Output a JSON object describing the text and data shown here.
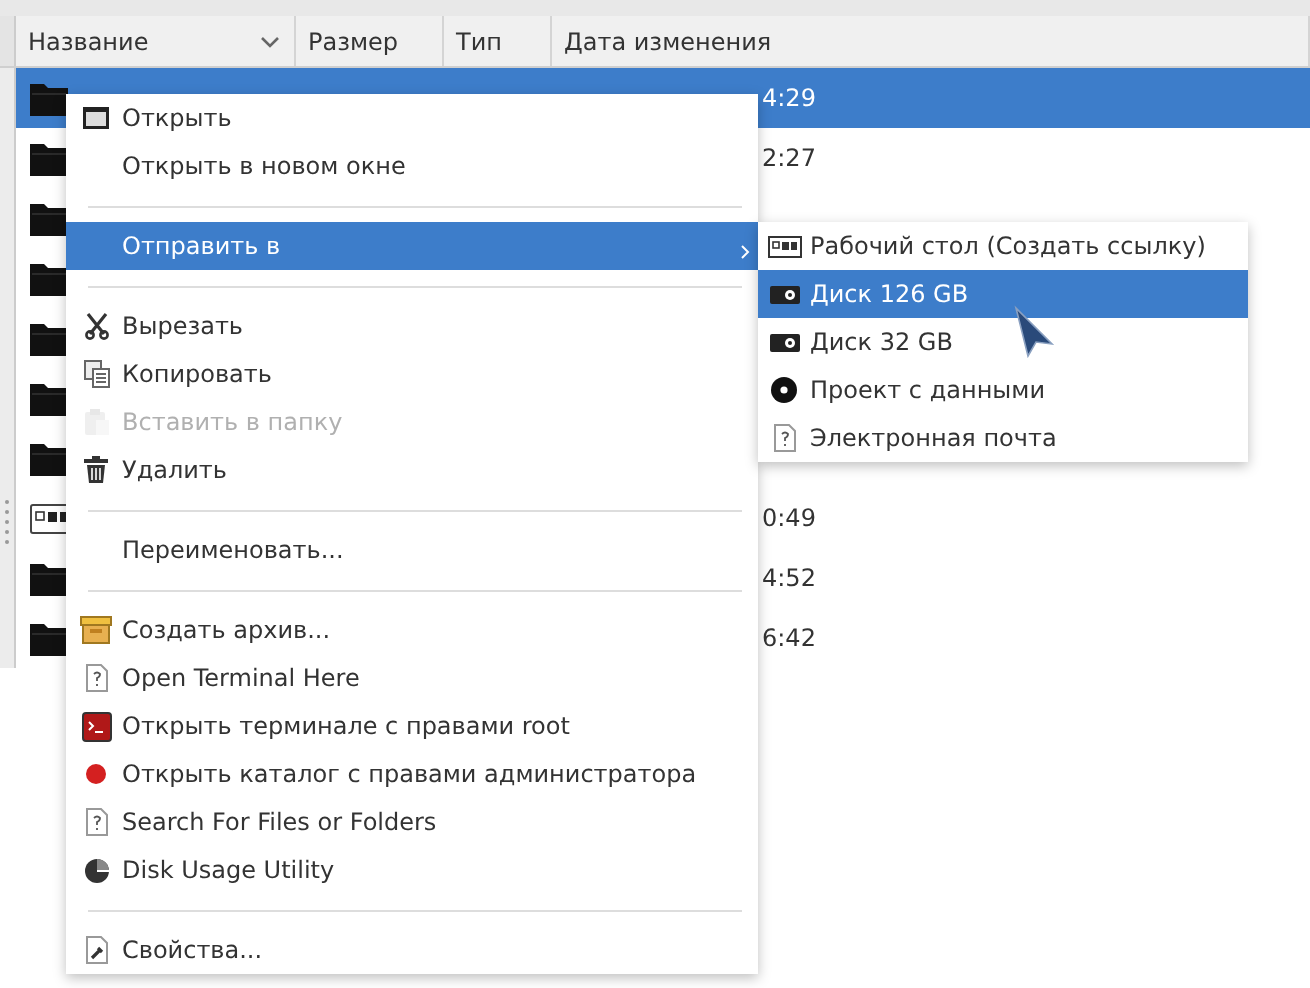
{
  "file_list": {
    "columns": [
      {
        "label": "Название",
        "sorted": true
      },
      {
        "label": "Размер",
        "sorted": false
      },
      {
        "label": "Тип",
        "sorted": false
      },
      {
        "label": "Дата изменения",
        "sorted": false
      }
    ],
    "rows": [
      {
        "kind": "folder",
        "selected": true,
        "date": "4:29"
      },
      {
        "kind": "folder",
        "selected": false,
        "date": "2:27"
      },
      {
        "kind": "folder",
        "selected": false
      },
      {
        "kind": "folder",
        "selected": false
      },
      {
        "kind": "folder",
        "selected": false
      },
      {
        "kind": "folder",
        "selected": false
      },
      {
        "kind": "folder",
        "selected": false
      },
      {
        "kind": "desktop",
        "selected": false,
        "date": "0:49"
      },
      {
        "kind": "folder",
        "selected": false,
        "date": "4:52"
      },
      {
        "kind": "folder",
        "selected": false,
        "date": "6:42"
      }
    ]
  },
  "context_menu": {
    "items": [
      {
        "kind": "item",
        "label": "Открыть",
        "selected": false,
        "disabled": false,
        "has_submenu": false
      },
      {
        "kind": "item",
        "label": "Открыть в новом окне",
        "selected": false,
        "disabled": false,
        "has_submenu": false
      },
      {
        "kind": "separator"
      },
      {
        "kind": "item",
        "label": "Отправить в",
        "selected": true,
        "disabled": false,
        "has_submenu": true
      },
      {
        "kind": "separator"
      },
      {
        "kind": "item",
        "label": "Вырезать",
        "selected": false,
        "disabled": false,
        "has_submenu": false
      },
      {
        "kind": "item",
        "label": "Копировать",
        "selected": false,
        "disabled": false,
        "has_submenu": false
      },
      {
        "kind": "item",
        "label": "Вставить в папку",
        "selected": false,
        "disabled": true,
        "has_submenu": false
      },
      {
        "kind": "item",
        "label": "Удалить",
        "selected": false,
        "disabled": false,
        "has_submenu": false
      },
      {
        "kind": "separator"
      },
      {
        "kind": "item",
        "label": "Переименовать...",
        "selected": false,
        "disabled": false,
        "has_submenu": false
      },
      {
        "kind": "separator"
      },
      {
        "kind": "item",
        "label": "Создать архив...",
        "selected": false,
        "disabled": false,
        "has_submenu": false
      },
      {
        "kind": "item",
        "label": "Open Terminal Here",
        "selected": false,
        "disabled": false,
        "has_submenu": false
      },
      {
        "kind": "item",
        "label": "Открыть терминале с правами root",
        "selected": false,
        "disabled": false,
        "has_submenu": false
      },
      {
        "kind": "item",
        "label": "Открыть каталог с правами администратора",
        "selected": false,
        "disabled": false,
        "has_submenu": false
      },
      {
        "kind": "item",
        "label": "Search For Files or Folders",
        "selected": false,
        "disabled": false,
        "has_submenu": false
      },
      {
        "kind": "item",
        "label": "Disk Usage Utility",
        "selected": false,
        "disabled": false,
        "has_submenu": false
      },
      {
        "kind": "separator"
      },
      {
        "kind": "item",
        "label": "Свойства...",
        "selected": false,
        "disabled": false,
        "has_submenu": false
      }
    ]
  },
  "send_to_submenu": {
    "items": [
      {
        "kind": "item",
        "label": "Рабочий стол (Создать ссылку)",
        "selected": false
      },
      {
        "kind": "item",
        "label": "Диск 126 GB",
        "selected": true
      },
      {
        "kind": "item",
        "label": "Диск 32 GB",
        "selected": false
      },
      {
        "kind": "item",
        "label": "Проект с данными",
        "selected": false
      },
      {
        "kind": "item",
        "label": "Электронная почта",
        "selected": false
      }
    ]
  }
}
